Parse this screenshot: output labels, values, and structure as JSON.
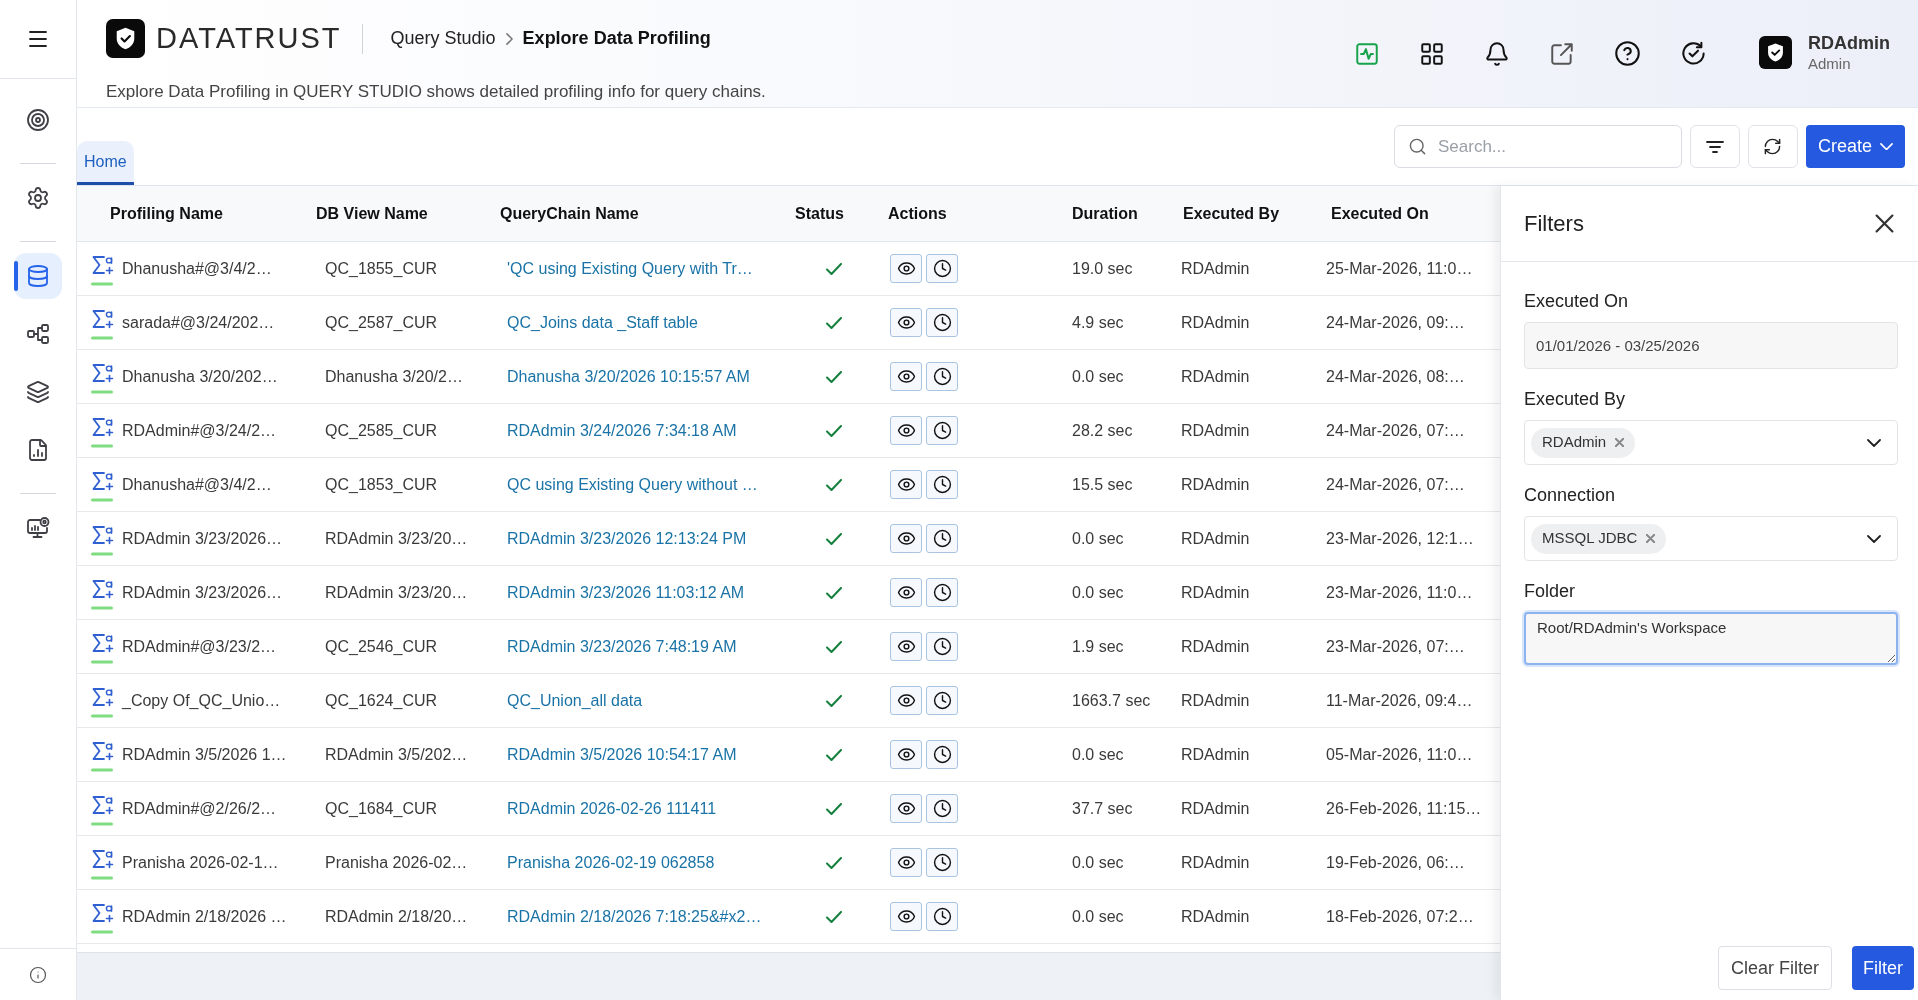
{
  "sidebar": {
    "groups": [
      {
        "items": [
          {
            "kind": "target",
            "selected": false
          }
        ]
      },
      {
        "items": [
          {
            "kind": "settings",
            "selected": false
          }
        ]
      },
      {
        "items": [
          {
            "kind": "database",
            "selected": true
          },
          {
            "kind": "flow",
            "selected": false
          },
          {
            "kind": "layers",
            "selected": false
          },
          {
            "kind": "report",
            "selected": false
          }
        ]
      },
      {
        "items": [
          {
            "kind": "monitor",
            "selected": false
          }
        ]
      }
    ]
  },
  "header": {
    "brand": "DATATRUST",
    "breadcrumb": [
      {
        "label": "Query Studio",
        "current": false
      },
      {
        "label": "Explore Data Profiling",
        "current": true
      }
    ],
    "description": "Explore Data Profiling in QUERY STUDIO shows detailed profiling info for query chains.",
    "user": {
      "name": "RDAdmin",
      "role": "Admin"
    }
  },
  "tabs": [
    {
      "label": "Home",
      "selected": true
    }
  ],
  "toolbar": {
    "search": {
      "placeholder": "Search..."
    },
    "create_button": "Create"
  },
  "table": {
    "columns": [
      "Profiling Name",
      "DB View Name",
      "QueryChain Name",
      "Status",
      "Actions",
      "Duration",
      "Executed By",
      "Executed On"
    ],
    "rows": [
      {
        "profiling_name": "Dhanusha#@3/4/2…",
        "db_view_name": "QC_1855_CUR",
        "querychain_name": "'QC using Existing Query with Tr…",
        "succeeded": true,
        "duration": "19.0 sec",
        "executed_by": "RDAdmin",
        "executed_on": "25-Mar-2026, 11:0…"
      },
      {
        "profiling_name": "sarada#@3/24/202…",
        "db_view_name": "QC_2587_CUR",
        "querychain_name": "QC_Joins data _Staff table",
        "succeeded": true,
        "duration": "4.9 sec",
        "executed_by": "RDAdmin",
        "executed_on": "24-Mar-2026, 09:…"
      },
      {
        "profiling_name": "Dhanusha 3/20/202…",
        "db_view_name": "Dhanusha 3/20/2…",
        "querychain_name": "Dhanusha 3/20/2026 10:15:57 AM",
        "succeeded": true,
        "duration": "0.0 sec",
        "executed_by": "RDAdmin",
        "executed_on": "24-Mar-2026, 08:…"
      },
      {
        "profiling_name": "RDAdmin#@3/24/2…",
        "db_view_name": "QC_2585_CUR",
        "querychain_name": "RDAdmin 3/24/2026 7:34:18 AM",
        "succeeded": true,
        "duration": "28.2 sec",
        "executed_by": "RDAdmin",
        "executed_on": "24-Mar-2026, 07:…"
      },
      {
        "profiling_name": "Dhanusha#@3/4/2…",
        "db_view_name": "QC_1853_CUR",
        "querychain_name": "QC using Existing Query without …",
        "succeeded": true,
        "duration": "15.5 sec",
        "executed_by": "RDAdmin",
        "executed_on": "24-Mar-2026, 07:…"
      },
      {
        "profiling_name": "RDAdmin 3/23/2026…",
        "db_view_name": "RDAdmin 3/23/20…",
        "querychain_name": "RDAdmin 3/23/2026 12:13:24 PM",
        "succeeded": true,
        "duration": "0.0 sec",
        "executed_by": "RDAdmin",
        "executed_on": "23-Mar-2026, 12:1…"
      },
      {
        "profiling_name": "RDAdmin 3/23/2026…",
        "db_view_name": "RDAdmin 3/23/20…",
        "querychain_name": "RDAdmin 3/23/2026 11:03:12 AM",
        "succeeded": true,
        "duration": "0.0 sec",
        "executed_by": "RDAdmin",
        "executed_on": "23-Mar-2026, 11:0…"
      },
      {
        "profiling_name": "RDAdmin#@3/23/2…",
        "db_view_name": "QC_2546_CUR",
        "querychain_name": "RDAdmin 3/23/2026 7:48:19 AM",
        "succeeded": true,
        "duration": "1.9 sec",
        "executed_by": "RDAdmin",
        "executed_on": "23-Mar-2026, 07:…"
      },
      {
        "profiling_name": "_Copy Of_QC_Unio…",
        "db_view_name": "QC_1624_CUR",
        "querychain_name": "QC_Union_all data",
        "succeeded": true,
        "duration": "1663.7 sec",
        "executed_by": "RDAdmin",
        "executed_on": "11-Mar-2026, 09:4…"
      },
      {
        "profiling_name": "RDAdmin 3/5/2026 1…",
        "db_view_name": "RDAdmin 3/5/202…",
        "querychain_name": "RDAdmin 3/5/2026 10:54:17 AM",
        "succeeded": true,
        "duration": "0.0 sec",
        "executed_by": "RDAdmin",
        "executed_on": "05-Mar-2026, 11:0…"
      },
      {
        "profiling_name": "RDAdmin#@2/26/2…",
        "db_view_name": "QC_1684_CUR",
        "querychain_name": "RDAdmin 2026-02-26 111411",
        "succeeded": true,
        "duration": "37.7 sec",
        "executed_by": "RDAdmin",
        "executed_on": "26-Feb-2026, 11:15…"
      },
      {
        "profiling_name": "Pranisha 2026-02-1…",
        "db_view_name": "Pranisha 2026-02…",
        "querychain_name": "Pranisha 2026-02-19 062858",
        "succeeded": true,
        "duration": "0.0 sec",
        "executed_by": "RDAdmin",
        "executed_on": "19-Feb-2026, 06:…"
      },
      {
        "profiling_name": "RDAdmin 2/18/2026 …",
        "db_view_name": "RDAdmin 2/18/20…",
        "querychain_name": "RDAdmin 2/18/2026 7:18:25&#x2…",
        "succeeded": true,
        "duration": "0.0 sec",
        "executed_by": "RDAdmin",
        "executed_on": "18-Feb-2026, 07:2…"
      }
    ]
  },
  "filters": {
    "title": "Filters",
    "fields": [
      {
        "kind": "date",
        "label": "Executed On",
        "value": "01/01/2026 - 03/25/2026",
        "focused": false
      },
      {
        "kind": "multiselect",
        "label": "Executed By",
        "tags": [
          "RDAdmin"
        ],
        "focused": false
      },
      {
        "kind": "multiselect",
        "label": "Connection",
        "tags": [
          "MSSQL JDBC"
        ],
        "focused": false
      },
      {
        "kind": "textarea",
        "label": "Folder",
        "value": "Root/RDAdmin's Workspace",
        "focused": true
      }
    ],
    "buttons": [
      {
        "label": "Clear Filter",
        "primary": false
      },
      {
        "label": "Filter",
        "primary": true
      }
    ]
  }
}
